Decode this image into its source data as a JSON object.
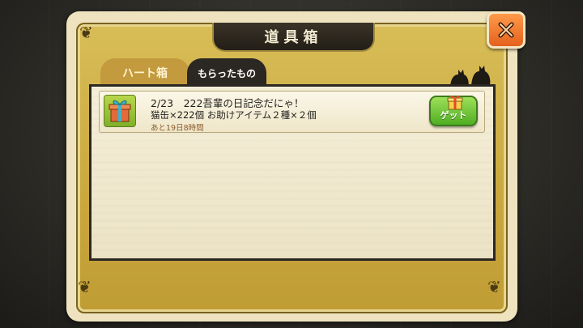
{
  "dialog": {
    "title": "道具箱",
    "close_label": "X"
  },
  "tabs": [
    {
      "label": "ハート箱",
      "active": false
    },
    {
      "label": "もらったもの",
      "active": true
    }
  ],
  "gifts": [
    {
      "title": "2/23　222吾輩の日記念だにゃ！",
      "description": "猫缶×222個 お助けアイテム２種×２個",
      "expiry": "あと19日8時間",
      "action_label": "ゲット",
      "icon": "gift-box-icon"
    }
  ],
  "colors": {
    "frame_gold": "#caa83f",
    "tab_active": "#2b2722",
    "get_button": "#4fae22",
    "close_button": "#e4611e"
  }
}
